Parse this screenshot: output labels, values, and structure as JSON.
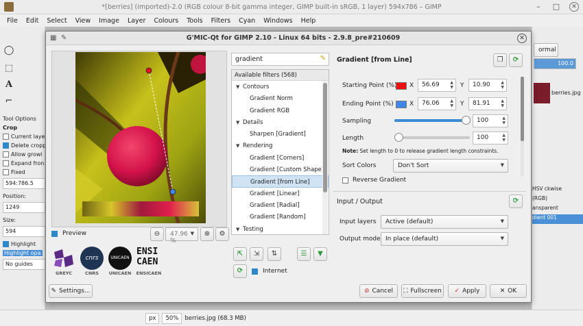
{
  "gimp": {
    "title": "*[berries] (imported)-2.0 (RGB colour 8-bit gamma integer, GIMP built-in sRGB, 1 layer) 594x786 – GIMP",
    "menu": [
      "File",
      "Edit",
      "Select",
      "View",
      "Image",
      "Layer",
      "Colours",
      "Tools",
      "Filters",
      "Cyan",
      "Windows",
      "Help"
    ],
    "tool_options": {
      "title": "Tool Options",
      "tool_name": "Crop",
      "current_layer": "Current laye",
      "delete_crop": "Delete cropp",
      "allow_grow": "Allow growi",
      "expand_from": "Expand fron",
      "fixed": "Fixed",
      "ratio": "594:786.5",
      "position_label": "Position:",
      "position_value": "1249",
      "size_label": "Size:",
      "size_value": "594",
      "highlight": "Highlight",
      "highlight_opacity": "Highlight opa",
      "guides": "No guides"
    },
    "right_dock": {
      "mode": "ormal",
      "opacity": "100.0",
      "image_thumb_label": "berries.jpg",
      "layer_items": [
        "HSV ckwise",
        "(RGB)",
        "ansparent",
        "dient 001"
      ]
    },
    "statusbar": {
      "unit": "px",
      "zoom": "50%",
      "file_info": "berries.jpg (68.3 MB)"
    }
  },
  "gmic": {
    "title": "G'MIC-Qt for GIMP 2.10 - Linux 64 bits - 2.9.8_pre#210609",
    "preview_label": "Preview",
    "zoom_value": "47.96 %",
    "logos": [
      "GREYC",
      "CNRS",
      "UNICAEN",
      "ENSICAEN"
    ],
    "logo_lines": {
      "cnrs": "cnrs",
      "unicaen": "UNICAEN",
      "ensi1": "ENSI",
      "ensi2": "CAEN"
    },
    "settings_label": "Settings...",
    "search_value": "gradient",
    "available_filters": "Available filters (568)",
    "tree": [
      {
        "type": "cat",
        "label": "Contours"
      },
      {
        "type": "leaf",
        "label": "Gradient Norm"
      },
      {
        "type": "leaf",
        "label": "Gradient RGB"
      },
      {
        "type": "cat",
        "label": "Details"
      },
      {
        "type": "leaf",
        "label": "Sharpen [Gradient]"
      },
      {
        "type": "cat",
        "label": "Rendering"
      },
      {
        "type": "leaf",
        "label": "Gradient [Corners]"
      },
      {
        "type": "leaf",
        "label": "Gradient [Custom Shape]"
      },
      {
        "type": "leaf",
        "label": "Gradient [from Line]",
        "selected": true
      },
      {
        "type": "leaf",
        "label": "Gradient [Linear]"
      },
      {
        "type": "leaf",
        "label": "Gradient [Radial]"
      },
      {
        "type": "leaf",
        "label": "Gradient [Random]"
      },
      {
        "type": "cat",
        "label": "Testing"
      }
    ],
    "internet_label": "Internet",
    "filter_title": "Gradient [from Line]",
    "params": {
      "start_label": "Starting Point (%)",
      "start_x": "56.69",
      "start_y": "10.90",
      "start_color": "#ee1111",
      "end_label": "Ending Point (%)",
      "end_x": "76.06",
      "end_y": "81.91",
      "end_color": "#3f86e6",
      "x_axis": "X",
      "y_axis": "Y",
      "sampling_label": "Sampling",
      "sampling_value": "100",
      "sampling_level": 1.0,
      "length_label": "Length",
      "length_value": "100",
      "length_level": 0.0,
      "note_bold": "Note:",
      "note_text": " Set length to 0 to release gradient length constraints.",
      "sort_label": "Sort Colors",
      "sort_value": "Don't Sort",
      "reverse_label": "Reverse Gradient"
    },
    "io": {
      "title": "Input / Output",
      "input_label": "Input layers",
      "input_value": "Active (default)",
      "output_label": "Output mode",
      "output_value": "In place (default)"
    },
    "buttons": {
      "cancel": "Cancel",
      "fullscreen": "Fullscreen",
      "apply": "Apply",
      "ok": "OK"
    }
  }
}
